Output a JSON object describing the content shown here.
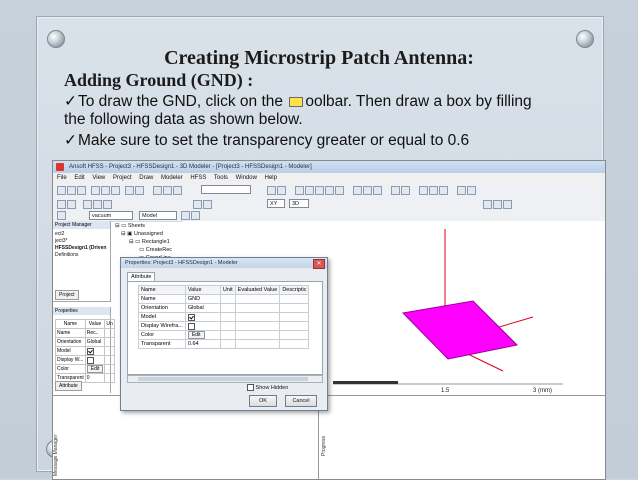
{
  "slide": {
    "title": "Creating Microstrip Patch Antenna:",
    "subtitle": "Adding Ground (GND) :",
    "bullet1_part1": "To draw the GND, click on the",
    "bullet1_part2": "oolbar. Then draw a box by filling",
    "bullet1_line2": "the following data as shown below.",
    "bullet2": "Make sure to set the transparency greater or equal to 0.6",
    "tick_glyph": "✓"
  },
  "app": {
    "window_title": "Ansoft HFSS - Project3 - HFSSDesign1 - 3D Modeler - [Project3 - HFSSDesign1 - Modeler]",
    "menu": [
      "File",
      "Edit",
      "View",
      "Project",
      "Draw",
      "Modeler",
      "HFSS",
      "Tools",
      "Window",
      "Help"
    ],
    "combo_material": "vacuum",
    "combo_model": "Model",
    "combo_plane": "XY",
    "combo_view": "3D"
  },
  "project_manager": {
    "header": "Project Manager",
    "lines": [
      "ect2",
      "ject3*",
      "HFSSDesign1 (Driven",
      "Definitions"
    ],
    "tab": "Project"
  },
  "tree": {
    "sheets": "Sheets",
    "unassigned": "Unassigned",
    "rectangle": "Rectangle1",
    "create_rect": "CreateRec",
    "cover_lines": "CoverLine"
  },
  "properties_panel": {
    "header": "Properties",
    "columns": [
      "Name",
      "Value",
      "Un"
    ],
    "rows": [
      [
        "Name",
        "Rec..",
        ""
      ],
      [
        "Orientation",
        "Global",
        ""
      ],
      [
        "Model",
        "",
        ""
      ],
      [
        "Display W...",
        "",
        ""
      ],
      [
        "Color",
        "Edit",
        ""
      ],
      [
        "Transparent",
        "0",
        ""
      ]
    ],
    "tab": "Attribute"
  },
  "viewport": {
    "scale_label_1": "1.5",
    "scale_label_2": "3 (mm)",
    "patch_color": "#ff00ff",
    "axis_color": "#e0001a"
  },
  "side_labels": {
    "left": "Message Manager",
    "right": "Progress"
  },
  "dialog": {
    "title": "Properties: Project3 - HFSSDesign1 - Modeler",
    "tab": "Attribute",
    "columns": [
      "Name",
      "Value",
      "Unit",
      "Evaluated Value",
      "Descriptic"
    ],
    "rows": [
      {
        "name": "Name",
        "value": "GND",
        "kind": "text"
      },
      {
        "name": "Orientation",
        "value": "Global",
        "kind": "text"
      },
      {
        "name": "Model",
        "value": "",
        "kind": "check-on"
      },
      {
        "name": "Display Wirefra...",
        "value": "",
        "kind": "check-off"
      },
      {
        "name": "Color",
        "value": "Edit",
        "kind": "button"
      },
      {
        "name": "Transparent",
        "value": "0.64",
        "kind": "text"
      }
    ],
    "show_hidden": "Show Hidden",
    "ok": "OK",
    "cancel": "Cancel"
  }
}
